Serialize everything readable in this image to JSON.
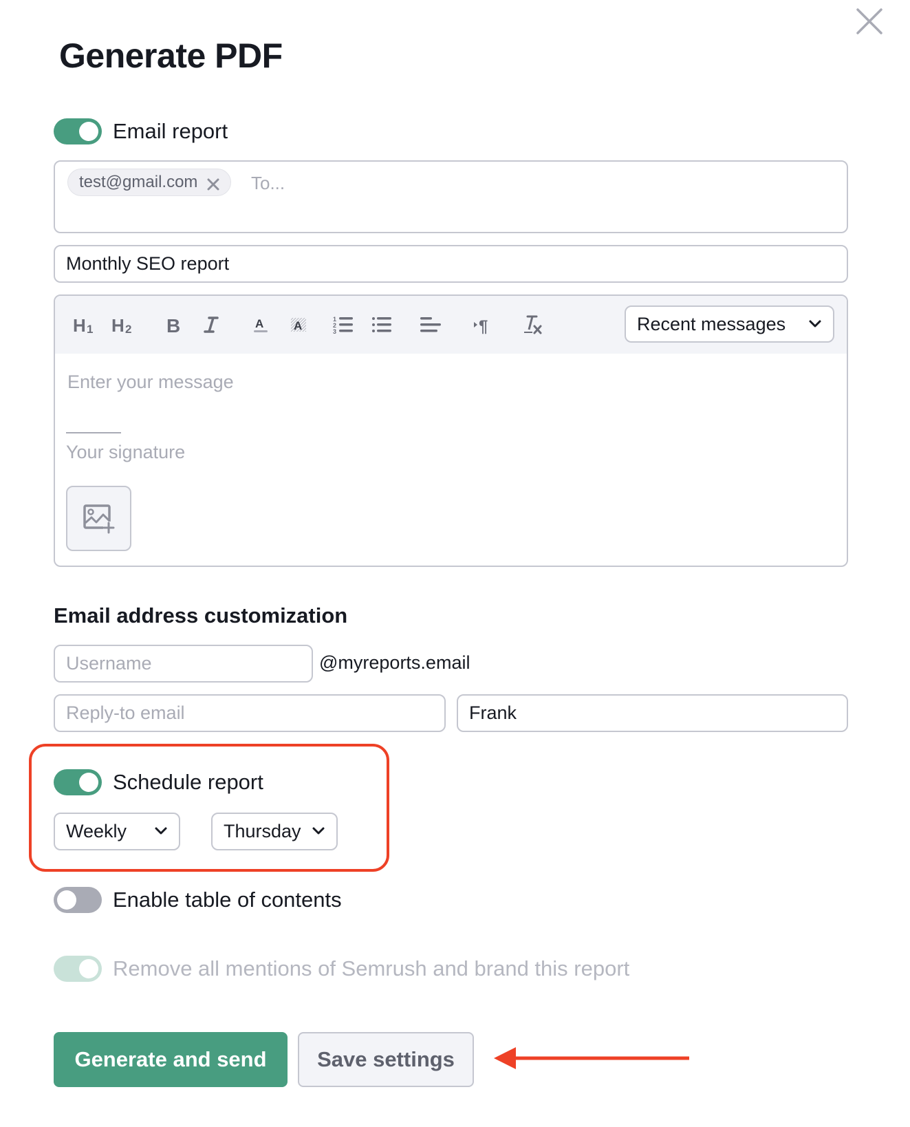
{
  "dialog": {
    "title": "Generate PDF",
    "close_icon": "close-icon"
  },
  "email_report": {
    "label": "Email report",
    "enabled": true,
    "recipients": [
      {
        "email": "test@gmail.com",
        "remove_icon": "close-icon"
      }
    ],
    "to_placeholder": "To...",
    "subject": "Monthly SEO report"
  },
  "editor": {
    "toolbar": [
      {
        "name": "heading-1",
        "icon": "H1"
      },
      {
        "name": "heading-2",
        "icon": "H2"
      },
      {
        "name": "bold",
        "icon": "B"
      },
      {
        "name": "italic",
        "icon": "I"
      },
      {
        "name": "text-color",
        "icon": "A"
      },
      {
        "name": "highlight-color",
        "icon": "A"
      },
      {
        "name": "ordered-list",
        "icon": "ordered-list-icon"
      },
      {
        "name": "bullet-list",
        "icon": "bullet-list-icon"
      },
      {
        "name": "align",
        "icon": "align-icon"
      },
      {
        "name": "text-direction",
        "icon": "pilcrow-icon"
      },
      {
        "name": "clear-format",
        "icon": "clear-format-icon"
      }
    ],
    "recent_messages_label": "Recent messages",
    "message_placeholder": "Enter your message",
    "signature_placeholder": "Your signature",
    "add_image_icon": "add-image-icon"
  },
  "customization": {
    "title": "Email address customization",
    "username_placeholder": "Username",
    "domain_suffix": "@myreports.email",
    "reply_to_placeholder": "Reply-to email",
    "from_name_value": "Frank"
  },
  "schedule": {
    "label": "Schedule report",
    "enabled": true,
    "frequency": "Weekly",
    "day": "Thursday"
  },
  "toc": {
    "label": "Enable table of contents",
    "enabled": false
  },
  "branding": {
    "label": "Remove all mentions of Semrush and brand this report",
    "enabled": true,
    "disabled": true
  },
  "actions": {
    "generate_label": "Generate and send",
    "save_label": "Save settings"
  },
  "annotations": {
    "highlight_color": "#ee4126",
    "arrow_target": "save-settings-button"
  },
  "colors": {
    "accent": "#489d80",
    "annotation": "#ee4126"
  }
}
